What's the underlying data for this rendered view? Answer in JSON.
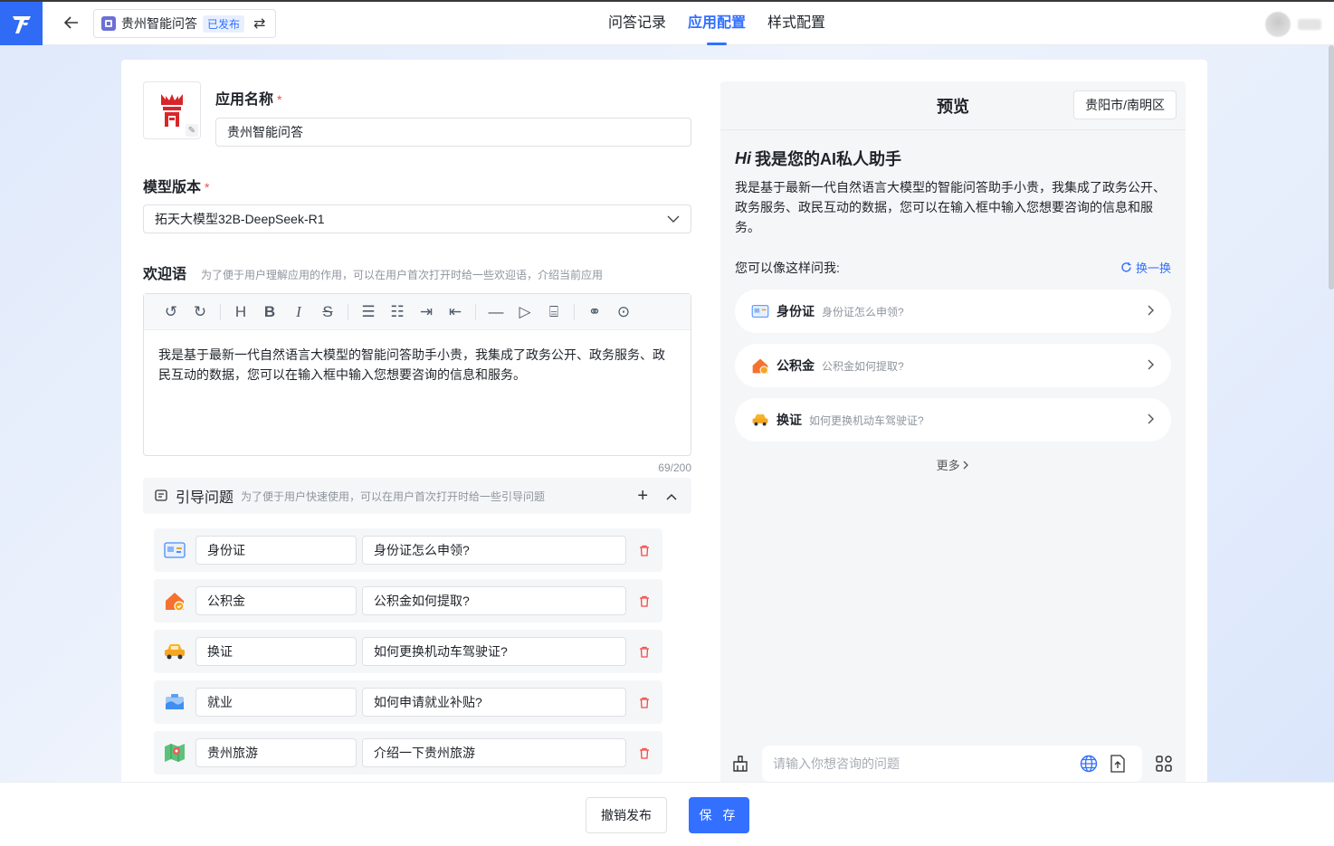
{
  "header": {
    "app_name": "贵州智能问答",
    "status_badge": "已发布",
    "tabs": [
      {
        "label": "问答记录",
        "active": false
      },
      {
        "label": "应用配置",
        "active": true
      },
      {
        "label": "样式配置",
        "active": false
      }
    ]
  },
  "form": {
    "app_name_label": "应用名称",
    "app_name_value": "贵州智能问答",
    "required_mark": "*",
    "model_label": "模型版本",
    "model_value": "拓天大模型32B-DeepSeek-R1",
    "welcome_label": "欢迎语",
    "welcome_hint": "为了便于用户理解应用的作用，可以在用户首次打开时给一些欢迎语，介绍当前应用",
    "welcome_text": "我是基于最新一代自然语言大模型的智能问答助手小贵，我集成了政务公开、政务服务、政民互动的数据，您可以在输入框中输入您想要咨询的信息和服务。",
    "char_counter": "69/200",
    "guide_label": "引导问题",
    "guide_hint": "为了便于用户快速使用，可以在用户首次打开时给一些引导问题"
  },
  "guide_questions": [
    {
      "title": "身份证",
      "question": "身份证怎么申领?",
      "icon": "id-card-icon"
    },
    {
      "title": "公积金",
      "question": "公积金如何提取?",
      "icon": "house-fund-icon"
    },
    {
      "title": "换证",
      "question": "如何更换机动车驾驶证?",
      "icon": "car-icon"
    },
    {
      "title": "就业",
      "question": "如何申请就业补贴?",
      "icon": "employment-icon"
    },
    {
      "title": "贵州旅游",
      "question": "介绍一下贵州旅游",
      "icon": "map-icon"
    }
  ],
  "preview": {
    "title": "预览",
    "location": "贵阳市/南明区",
    "hi": "Hi",
    "greeting": "我是您的AI私人助手",
    "desc": "我是基于最新一代自然语言大模型的智能问答助手小贵，我集成了政务公开、政务服务、政民互动的数据，您可以在输入框中输入您想要咨询的信息和服务。",
    "ask_label": "您可以像这样问我:",
    "refresh_label": "换一换",
    "questions": [
      {
        "title": "身份证",
        "sub": "身份证怎么申领?"
      },
      {
        "title": "公积金",
        "sub": "公积金如何提取?"
      },
      {
        "title": "换证",
        "sub": "如何更换机动车驾驶证?"
      }
    ],
    "more_label": "更多",
    "input_placeholder": "请输入你想咨询的问题"
  },
  "footer": {
    "cancel_label": "撤销发布",
    "save_label": "保 存"
  },
  "colors": {
    "accent": "#3370ff",
    "required": "#f54a45",
    "delete": "#f54a45"
  }
}
